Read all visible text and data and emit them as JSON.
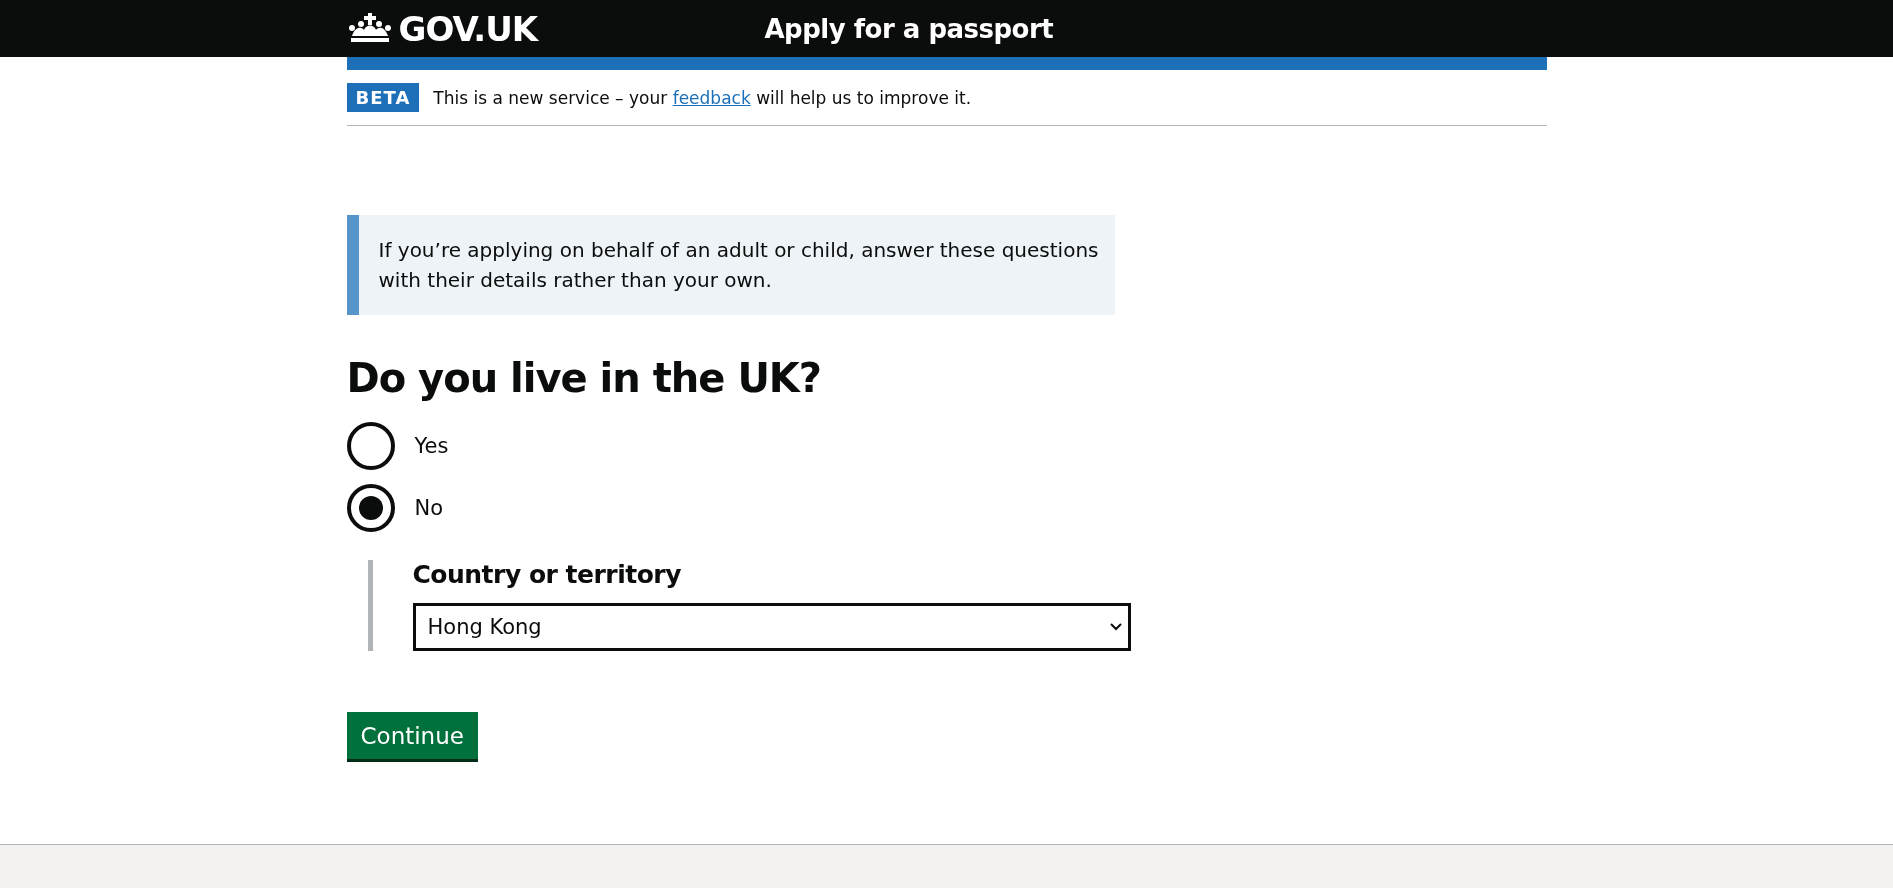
{
  "header": {
    "logo": "GOV.UK",
    "service_name": "Apply for a passport"
  },
  "phase_banner": {
    "tag": "BETA",
    "text_before": "This is a new service – your ",
    "link": "feedback",
    "text_after": " will help us to improve it."
  },
  "inset_text": "If you’re applying on behalf of an adult or child, answer these questions with their details rather than your own.",
  "question": {
    "heading": "Do you live in the UK?",
    "options": [
      {
        "label": "Yes",
        "selected": false
      },
      {
        "label": "No",
        "selected": true,
        "conditional": {
          "label": "Country or territory",
          "value": "Hong Kong"
        }
      }
    ]
  },
  "button": "Continue"
}
